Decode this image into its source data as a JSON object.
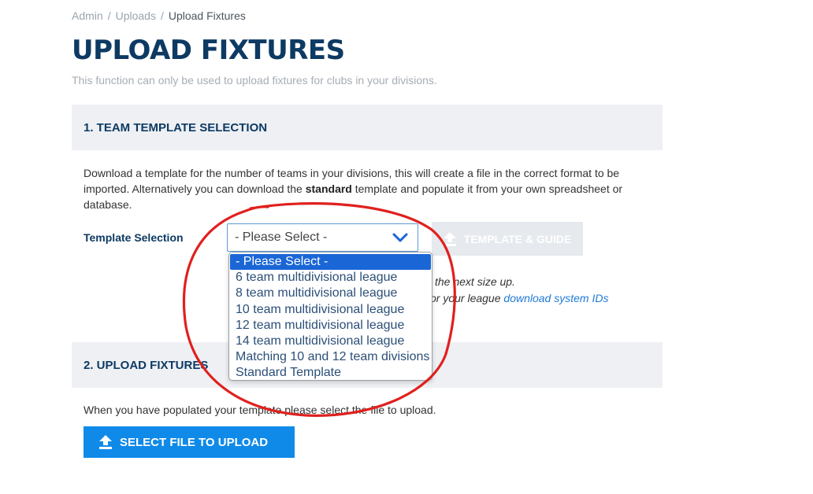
{
  "breadcrumb": [
    "Admin",
    "Uploads",
    "Upload Fixtures"
  ],
  "page": {
    "title": "UPLOAD FIXTURES",
    "subtitle": "This function can only be used to upload fixtures for clubs in your divisions."
  },
  "section1": {
    "header": "1. TEAM TEMPLATE SELECTION",
    "description_start": "Download a template for the number of teams in your divisions, this will create a file in the correct format to be imported. Alternatively you can download the ",
    "description_bold": "standard",
    "description_end": " template and populate it from your own spreadsheet or database.",
    "template_label": "Template Selection",
    "select_value": "- Please Select -",
    "options": [
      "- Please Select -",
      "6 team multidivisional league",
      "8 team multidivisional league",
      "10 team multidivisional league",
      "12 team multidivisional league",
      "14 team multidivisional league",
      "Matching 10 and 12 team divisions",
      "Standard Template"
    ],
    "template_button": "TEMPLATE & GUIDE",
    "note1": "the next size up.",
    "note2_text": "or your league ",
    "note2_link": "download system IDs"
  },
  "section2": {
    "header": "2. UPLOAD FIXTURES",
    "description": "When you have populated your template please select the file to upload.",
    "upload_button": "SELECT FILE TO UPLOAD"
  },
  "icons": {
    "upload": "upload-icon",
    "chevron": "chevron-down-icon"
  },
  "colors": {
    "title": "#0d3a63",
    "primary_button": "#0f8ae9",
    "selected_option": "#1a66d6",
    "annotation": "#e0201e"
  }
}
